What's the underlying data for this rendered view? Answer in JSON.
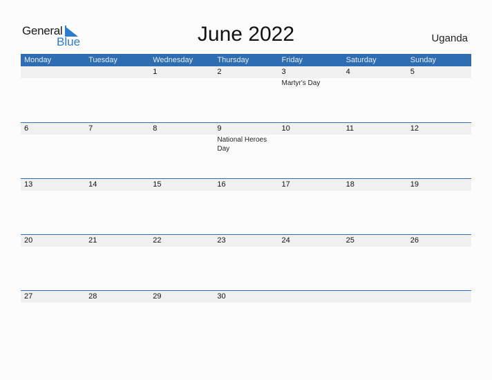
{
  "logo": {
    "general": "General",
    "blue": "Blue"
  },
  "title": "June 2022",
  "country": "Uganda",
  "colors": {
    "accent": "#2e6db1",
    "band": "#f0f0f0",
    "logo_blue": "#2b7bd0"
  },
  "weekdays": [
    "Monday",
    "Tuesday",
    "Wednesday",
    "Thursday",
    "Friday",
    "Saturday",
    "Sunday"
  ],
  "weeks": [
    {
      "days": [
        "",
        "",
        "1",
        "2",
        "3",
        "4",
        "5"
      ],
      "events": [
        "",
        "",
        "",
        "",
        "Martyr's Day",
        "",
        ""
      ]
    },
    {
      "days": [
        "6",
        "7",
        "8",
        "9",
        "10",
        "11",
        "12"
      ],
      "events": [
        "",
        "",
        "",
        "National Heroes Day",
        "",
        "",
        ""
      ]
    },
    {
      "days": [
        "13",
        "14",
        "15",
        "16",
        "17",
        "18",
        "19"
      ],
      "events": [
        "",
        "",
        "",
        "",
        "",
        "",
        ""
      ]
    },
    {
      "days": [
        "20",
        "21",
        "22",
        "23",
        "24",
        "25",
        "26"
      ],
      "events": [
        "",
        "",
        "",
        "",
        "",
        "",
        ""
      ]
    },
    {
      "days": [
        "27",
        "28",
        "29",
        "30",
        "",
        "",
        ""
      ],
      "events": [
        "",
        "",
        "",
        "",
        "",
        "",
        ""
      ]
    }
  ]
}
